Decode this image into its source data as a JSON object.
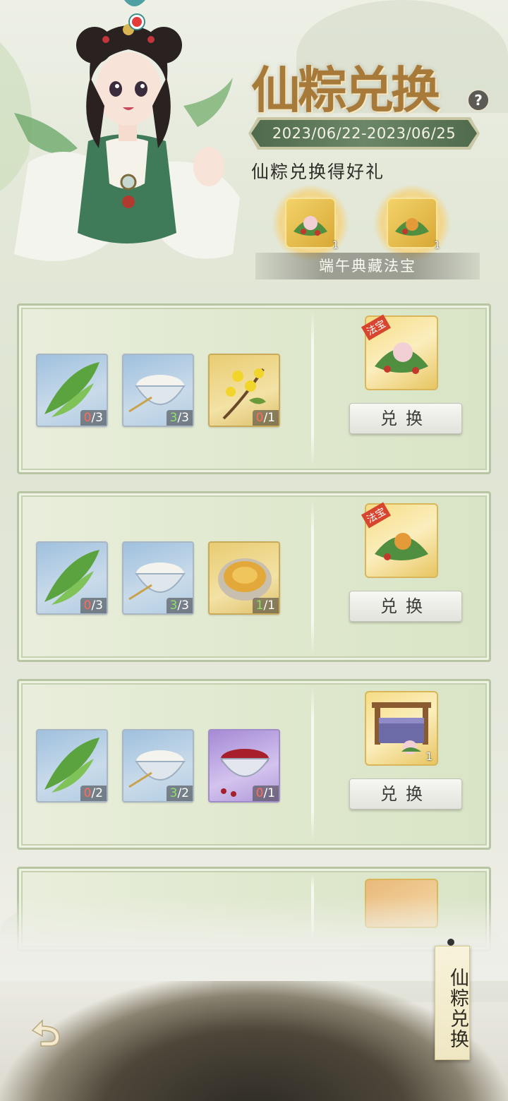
{
  "header": {
    "title": "仙粽兑换",
    "help_icon": "question-mark-icon",
    "date_range": "2023/06/22-2023/06/25",
    "gift_caption": "仙粽兑换得好礼",
    "preview_items": [
      {
        "icon": "zongzi-treasure-icon",
        "count": "1"
      },
      {
        "icon": "zongzi-treasure-icon",
        "count": "1"
      }
    ],
    "treasure_banner": "端午典藏法宝"
  },
  "exchanges": [
    {
      "materials": [
        {
          "icon": "bamboo-leaf-icon",
          "have": "0",
          "need": "3"
        },
        {
          "icon": "glutinous-rice-icon",
          "have": "3",
          "need": "3"
        },
        {
          "icon": "osmanthus-flower-icon",
          "have": "0",
          "need": "1"
        }
      ],
      "reward": {
        "tag": "法宝",
        "icon": "zongzi-treasure-icon",
        "count": ""
      },
      "button": "兑换"
    },
    {
      "materials": [
        {
          "icon": "bamboo-leaf-icon",
          "have": "0",
          "need": "3"
        },
        {
          "icon": "glutinous-rice-icon",
          "have": "3",
          "need": "3"
        },
        {
          "icon": "abalone-icon",
          "have": "1",
          "need": "1"
        }
      ],
      "reward": {
        "tag": "法宝",
        "icon": "zongzi-treasure-icon",
        "count": ""
      },
      "button": "兑换"
    },
    {
      "materials": [
        {
          "icon": "bamboo-leaf-icon",
          "have": "0",
          "need": "2"
        },
        {
          "icon": "glutinous-rice-icon",
          "have": "3",
          "need": "2"
        },
        {
          "icon": "red-bean-icon",
          "have": "0",
          "need": "1"
        }
      ],
      "reward": {
        "tag": "",
        "icon": "gift-box-icon",
        "count": "1"
      },
      "button": "兑换"
    }
  ],
  "side_tab": "仙粽兑换",
  "back_icon": "back-arrow-icon",
  "colors": {
    "accent_green": "#5b7757",
    "title_gold": "#a77a3a",
    "count_red": "#ff6b5b",
    "count_green": "#8de06a"
  }
}
